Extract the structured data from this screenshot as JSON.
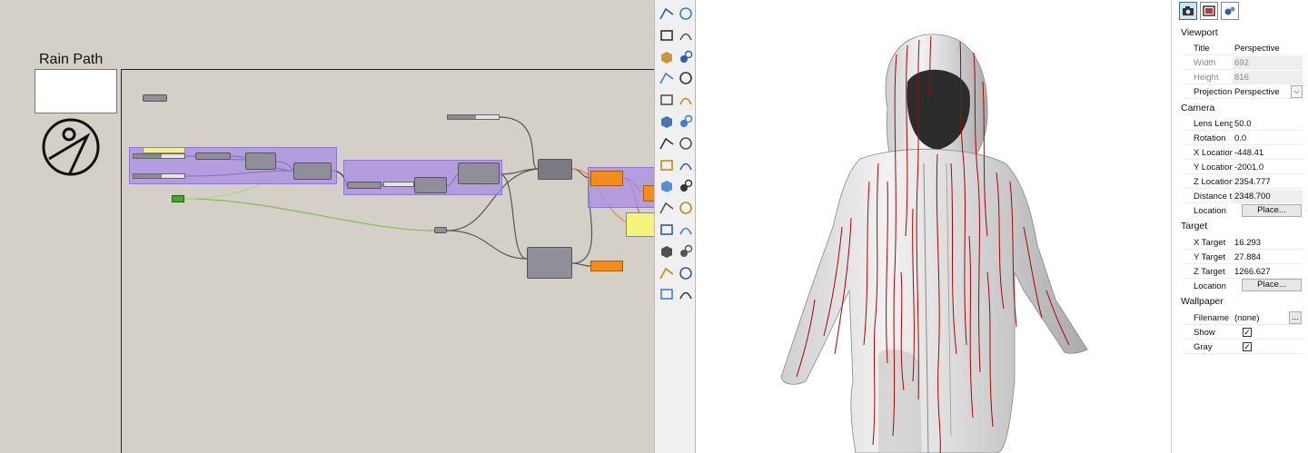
{
  "grasshopper": {
    "group_title": "Rain Path"
  },
  "toolbar": {
    "icons": [
      "curve-from-points-icon",
      "polyline-icon",
      "circle-icon",
      "arc-icon",
      "curve-icon",
      "rectangle-icon",
      "ellipse-icon",
      "fillet-icon",
      "surface-icon",
      "sweep-icon",
      "box-icon",
      "sphere-icon",
      "cylinder-icon",
      "extrude-icon",
      "boolean-icon",
      "explode-icon",
      "transform-icon",
      "mirror-icon",
      "array-icon",
      "dimension-icon",
      "text-icon",
      "scale-icon",
      "grid-icon",
      "snap-icon",
      "mesh-icon",
      "render-icon",
      "check-icon",
      "analyze-icon"
    ]
  },
  "colors": {
    "canvas": "#d4d0c8",
    "group": "#aa8ce6",
    "component": "#8f8e99",
    "output_orange": "#f28c1a",
    "panel_yellow": "#f5f37a",
    "toggle_green": "#44aa22",
    "rain_path": "#b00000"
  },
  "properties": {
    "tabs": [
      {
        "icon": "camera-icon",
        "active": true
      },
      {
        "icon": "display-icon",
        "active": false
      },
      {
        "icon": "object-properties-icon",
        "active": false
      }
    ],
    "viewport": {
      "heading": "Viewport",
      "title_label": "Title",
      "title_value": "Perspective",
      "width_label": "Width",
      "width_value": "692",
      "height_label": "Height",
      "height_value": "816",
      "projection_label": "Projection",
      "projection_value": "Perspective"
    },
    "camera": {
      "heading": "Camera",
      "lens_label": "Lens Length",
      "lens_value": "50.0",
      "rotation_label": "Rotation",
      "rotation_value": "0.0",
      "x_label": "X Location",
      "x_value": "-448.41",
      "y_label": "Y Location",
      "y_value": "-2001.0",
      "z_label": "Z Location",
      "z_value": "2354.777",
      "dist_label": "Distance t...",
      "dist_value": "2348.700",
      "location_label": "Location",
      "location_button": "Place..."
    },
    "target": {
      "heading": "Target",
      "x_label": "X Target",
      "x_value": "16.293",
      "y_label": "Y Target",
      "y_value": "27.884",
      "z_label": "Z Target",
      "z_value": "1266.627",
      "location_label": "Location",
      "location_button": "Place..."
    },
    "wallpaper": {
      "heading": "Wallpaper",
      "filename_label": "Filename",
      "filename_value": "(none)",
      "browse_button": "...",
      "show_label": "Show",
      "show_checked": true,
      "gray_label": "Gray",
      "gray_checked": true
    }
  }
}
